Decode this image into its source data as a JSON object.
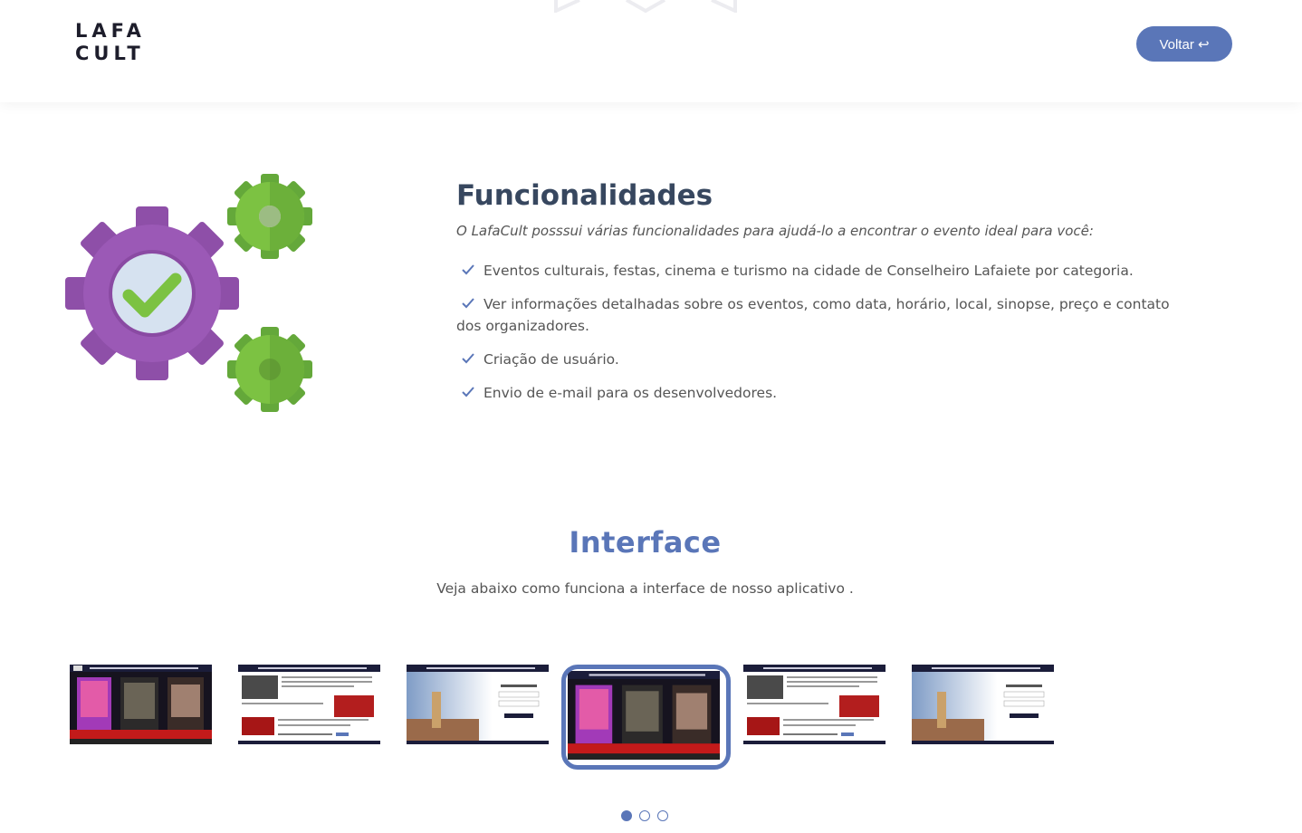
{
  "header": {
    "logo_line1": "LAFA",
    "logo_line2": "CULT",
    "back_label": "Voltar ↩"
  },
  "features": {
    "title": "Funcionalidades",
    "subtitle": "O LafaCult posssui várias funcionalidades para ajudá-lo a encontrar o evento ideal para você:",
    "items": [
      "Eventos culturais, festas, cinema e turismo na cidade de Conselheiro Lafaiete por categoria.",
      "Ver informações detalhadas sobre os eventos, como data, horário, local, sinopse, preço e contato dos organizadores.",
      "Criação de usuário.",
      "Envio de e-mail para os desenvolvedores."
    ]
  },
  "interface": {
    "title": "Interface",
    "subtitle": "Veja abaixo como funciona a interface de nosso aplicativo ."
  },
  "carousel": {
    "thumbnails": [
      "cinema-posters",
      "event-details",
      "login-screen",
      "cinema-posters",
      "event-details",
      "login-screen"
    ],
    "active_index": 3,
    "page_count": 3,
    "active_page": 0
  },
  "colors": {
    "accent": "#5a76b8",
    "heading": "#37475f",
    "gear_purple": "#9b59b6",
    "gear_green": "#7cc242",
    "check_green": "#7cc242"
  }
}
